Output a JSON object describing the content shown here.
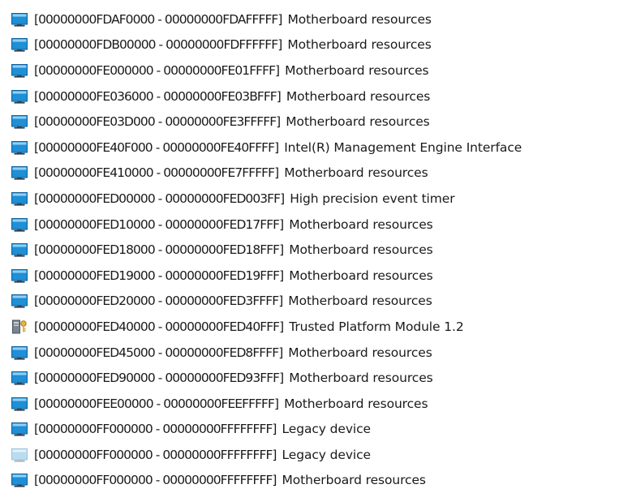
{
  "resources": [
    {
      "icon": "device-icon",
      "range": "[00000000FDAF0000 - 00000000FDAFFFFF]",
      "name": "Motherboard resources"
    },
    {
      "icon": "device-icon",
      "range": "[00000000FDB00000 - 00000000FDFFFFFF]",
      "name": "Motherboard resources"
    },
    {
      "icon": "device-icon",
      "range": "[00000000FE000000 - 00000000FE01FFFF]",
      "name": "Motherboard resources"
    },
    {
      "icon": "device-icon",
      "range": "[00000000FE036000 - 00000000FE03BFFF]",
      "name": "Motherboard resources"
    },
    {
      "icon": "device-icon",
      "range": "[00000000FE03D000 - 00000000FE3FFFFF]",
      "name": "Motherboard resources"
    },
    {
      "icon": "device-icon",
      "range": "[00000000FE40F000 - 00000000FE40FFFF]",
      "name": "Intel(R) Management Engine Interface"
    },
    {
      "icon": "device-icon",
      "range": "[00000000FE410000 - 00000000FE7FFFFF]",
      "name": "Motherboard resources"
    },
    {
      "icon": "device-icon",
      "range": "[00000000FED00000 - 00000000FED003FF]",
      "name": "High precision event timer"
    },
    {
      "icon": "device-icon",
      "range": "[00000000FED10000 - 00000000FED17FFF]",
      "name": "Motherboard resources"
    },
    {
      "icon": "device-icon",
      "range": "[00000000FED18000 - 00000000FED18FFF]",
      "name": "Motherboard resources"
    },
    {
      "icon": "device-icon",
      "range": "[00000000FED19000 - 00000000FED19FFF]",
      "name": "Motherboard resources"
    },
    {
      "icon": "device-icon",
      "range": "[00000000FED20000 - 00000000FED3FFFF]",
      "name": "Motherboard resources"
    },
    {
      "icon": "security-key-icon",
      "range": "[00000000FED40000 - 00000000FED40FFF]",
      "name": "Trusted Platform Module 1.2"
    },
    {
      "icon": "device-icon",
      "range": "[00000000FED45000 - 00000000FED8FFFF]",
      "name": "Motherboard resources"
    },
    {
      "icon": "device-icon",
      "range": "[00000000FED90000 - 00000000FED93FFF]",
      "name": "Motherboard resources"
    },
    {
      "icon": "device-icon",
      "range": "[00000000FEE00000 - 00000000FEEFFFFF]",
      "name": "Motherboard resources"
    },
    {
      "icon": "device-icon",
      "range": "[00000000FF000000 - 00000000FFFFFFFF]",
      "name": "Legacy device"
    },
    {
      "icon": "device-disabled-icon",
      "range": "[00000000FF000000 - 00000000FFFFFFFF]",
      "name": "Legacy device"
    },
    {
      "icon": "device-icon",
      "range": "[00000000FF000000 - 00000000FFFFFFFF]",
      "name": "Motherboard resources"
    }
  ]
}
